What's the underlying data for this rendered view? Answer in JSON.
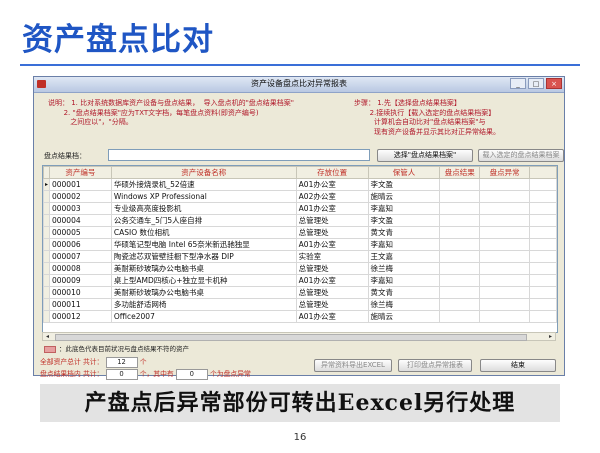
{
  "slide": {
    "title": "资产盘点比对",
    "caption": "产盘点后异常部份可转出Eexcel另行处理",
    "page_number": "16"
  },
  "window": {
    "title": "资产设备盘点比对异常报表",
    "buttons": {
      "minimize": "_",
      "maximize": "□",
      "close": "×"
    }
  },
  "instructions": {
    "left": "说明： 1. 比对系统数据库资产设备与盘点结果，  导入盘点机的\"盘点结果档案\"\n       2. \"盘点结果档案\"应为TXT文字档，每笔盘点资料(即资产编号)\n          之间应以\"，\"分隔。",
    "right": "步骤： 1.先【选择盘点结果档案】\n       2.接续执行【载入选定的盘点结果档案】\n         计算机会自动比对\"盘点结果档案\"与\n         现有资产设备并显示其比对正异常结果。"
  },
  "file_row": {
    "label": "盘点结果档：",
    "value": "",
    "select_button": "选择\"盘点结果档案\"",
    "load_button": "载入选定的盘点结果档案"
  },
  "table": {
    "columns": [
      "资产编号",
      "资产设备名称",
      "存放位置",
      "保管人",
      "盘点结果",
      "盘点异常"
    ],
    "rows": [
      {
        "indicator": "▸",
        "cells": [
          "000001",
          "华硕外接烧录机_52倍速",
          "A01办公室",
          "李文盈",
          "",
          ""
        ]
      },
      {
        "indicator": "",
        "cells": [
          "000002",
          "Windows XP Professional",
          "A02办公室",
          "施晴云",
          "",
          ""
        ]
      },
      {
        "indicator": "",
        "cells": [
          "000003",
          "专业级高亮度投影机",
          "A01办公室",
          "李嘉知",
          "",
          ""
        ]
      },
      {
        "indicator": "",
        "cells": [
          "000004",
          "公务交通车_5门5人座自排",
          "总管理处",
          "李文盈",
          "",
          ""
        ]
      },
      {
        "indicator": "",
        "cells": [
          "000005",
          "CASIO 数位相机",
          "总管理处",
          "黄文青",
          "",
          ""
        ]
      },
      {
        "indicator": "",
        "cells": [
          "000006",
          "华硕笔记型电脑 Intel 65奈米新迅驰独显",
          "A01办公室",
          "李嘉知",
          "",
          ""
        ]
      },
      {
        "indicator": "",
        "cells": [
          "000007",
          "陶瓷滤芯双管壁挂橱下型净水器 DIP",
          "实验室",
          "王文嘉",
          "",
          ""
        ]
      },
      {
        "indicator": "",
        "cells": [
          "000008",
          "美耐斯砂玻璃办公电脑书桌",
          "总管理处",
          "徐兰梅",
          "",
          ""
        ]
      },
      {
        "indicator": "",
        "cells": [
          "000009",
          "桌上型AMD四核心+独立显卡机种",
          "A01办公室",
          "李嘉知",
          "",
          ""
        ]
      },
      {
        "indicator": "",
        "cells": [
          "000010",
          "美耐斯砂玻璃办公电脑书桌",
          "总管理处",
          "黄文青",
          "",
          ""
        ]
      },
      {
        "indicator": "",
        "cells": [
          "000011",
          "多功能舒适网椅",
          "总管理处",
          "徐兰梅",
          "",
          ""
        ]
      },
      {
        "indicator": "",
        "cells": [
          "000012",
          "Office2007",
          "A01办公室",
          "施晴云",
          "",
          ""
        ]
      }
    ]
  },
  "legend": "：此底色代表目前状况与盘点结果不符的资产",
  "totals": {
    "all_label": "全部资产总计 共计：",
    "all_value": "12",
    "all_unit": "个",
    "result_label": "盘点结果档内 共计：",
    "result_value": "0",
    "result_mid": "个，其中有",
    "abnormal_value": "0",
    "abnormal_unit": "个为盘点异常"
  },
  "action_buttons": {
    "export": "异常资料导出EXCEL",
    "print": "打印盘点异常报表",
    "close": "结束"
  },
  "colors": {
    "title_blue": "#1f56c4",
    "instruction_red": "#b0182a",
    "header_red": "#c03028"
  }
}
